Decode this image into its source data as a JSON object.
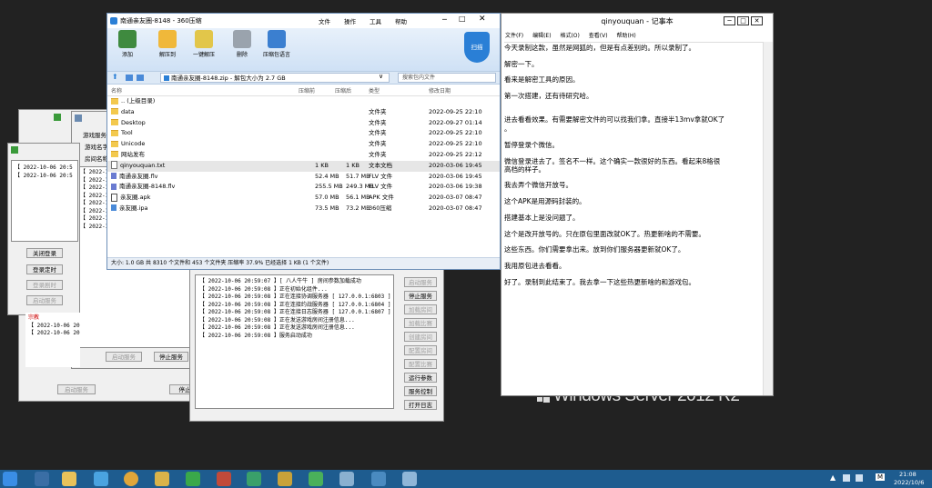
{
  "desktop": {
    "brand": "Windows Server 2012 R2"
  },
  "back_windows": {
    "w1": {
      "log_lines": [
        "【 2022-10-06 20:5",
        "【 2022-10-06 20:5"
      ],
      "buttons": [
        "关闭登录",
        "登录定时",
        "登录剧时",
        "启动服务"
      ],
      "extra_tag": "宗教",
      "log2": [
        "【 2022-10-06 20:5",
        "【 2022-10-06 20:5"
      ]
    },
    "w2": {
      "labels": [
        "游戏服务器",
        "游戏名字",
        "房间名称"
      ],
      "log_lines": [
        "【 2022-10",
        "【 2022-10",
        "【 2022-10",
        "【 2022-10",
        "【 2022-10",
        "【 2022-10",
        "【 2022-10",
        "【 2022-10"
      ],
      "start_btn": "启动服务",
      "stop_btn": "停止服务"
    },
    "w3": {
      "start_btn": "启动服务",
      "stop_btn": "停止"
    }
  },
  "server_window": {
    "log_lines": [
      "【 2022-10-06 20:59:07 】[ 八人牛牛 ] 房间参数加载成功",
      "【 2022-10-06 20:59:08 】正在初始化组件...",
      "【 2022-10-06 20:59:08 】正在连接协调服务器 [ 127.0.0.1:6803 ]",
      "【 2022-10-06 20:59:08 】正在连接约战服务器 [ 127.0.0.1:6804 ]",
      "【 2022-10-06 20:59:08 】正在连接日志服务器 [ 127.0.0.1:6807 ]",
      "【 2022-10-06 20:59:08 】正在发送游戏房间注册信息...",
      "【 2022-10-06 20:59:08 】正在发送游戏房间注册信息...",
      "【 2022-10-06 20:59:08 】服务启动成功"
    ],
    "buttons": [
      {
        "label": "启动服务",
        "enabled": false
      },
      {
        "label": "停止服务",
        "enabled": true
      },
      {
        "label": "加载房间",
        "enabled": false
      },
      {
        "label": "加载比赛",
        "enabled": false
      },
      {
        "label": "创建房间",
        "enabled": false
      },
      {
        "label": "配置房间",
        "enabled": false
      },
      {
        "label": "配置比赛",
        "enabled": false
      },
      {
        "label": "运行参数",
        "enabled": true
      },
      {
        "label": "服务控制",
        "enabled": true
      },
      {
        "label": "打开日志",
        "enabled": true
      }
    ]
  },
  "zip": {
    "title": "南通亲友圈-8148 - 360压缩",
    "menu": [
      "文件",
      "操作",
      "工具",
      "帮助"
    ],
    "toolbar": [
      "添加",
      "解压到",
      "一键解压",
      "删除",
      "压缩包语言"
    ],
    "scan_label": "扫描",
    "address": "南通亲友圈-8148.zip - 解包大小为 2.7 GB",
    "search_placeholder": "搜索包内文件",
    "columns": [
      "名称",
      "压缩前",
      "压缩后",
      "类型",
      "修改日期"
    ],
    "files": [
      {
        "name": ".. (上级目录)",
        "before": "",
        "after": "",
        "type": "",
        "date": "",
        "icon": "folder"
      },
      {
        "name": "data",
        "before": "",
        "after": "",
        "type": "文件夹",
        "date": "2022-09-25 22:10",
        "icon": "folder"
      },
      {
        "name": "Desktop",
        "before": "",
        "after": "",
        "type": "文件夹",
        "date": "2022-09-27 01:14",
        "icon": "folder"
      },
      {
        "name": "Tool",
        "before": "",
        "after": "",
        "type": "文件夹",
        "date": "2022-09-25 22:10",
        "icon": "folder"
      },
      {
        "name": "Unicode",
        "before": "",
        "after": "",
        "type": "文件夹",
        "date": "2022-09-25 22:10",
        "icon": "folder"
      },
      {
        "name": "网站发布",
        "before": "",
        "after": "",
        "type": "文件夹",
        "date": "2022-09-25 22:12",
        "icon": "folder"
      },
      {
        "name": "qinyouquan.txt",
        "before": "1 KB",
        "after": "1 KB",
        "type": "文本文档",
        "date": "2020-03-06 19:45",
        "icon": "file"
      },
      {
        "name": "南通亲友圈.flv",
        "before": "52.4 MB",
        "after": "51.7 MB",
        "type": "FLV 文件",
        "date": "2020-03-06 19:45",
        "icon": "flv"
      },
      {
        "name": "南通亲友圈-8148.flv",
        "before": "255.5 MB",
        "after": "249.3 MB",
        "type": "FLV 文件",
        "date": "2020-03-06 19:38",
        "icon": "flv"
      },
      {
        "name": "亲友圈.apk",
        "before": "57.0 MB",
        "after": "56.1 MB",
        "type": "APK 文件",
        "date": "2020-03-07 08:47",
        "icon": "apk"
      },
      {
        "name": "亲友圈.ipa",
        "before": "73.5 MB",
        "after": "73.2 MB",
        "type": "360压缩",
        "date": "2020-03-07 08:47",
        "icon": "ipa"
      }
    ],
    "status": "大小: 1.0 GB 共 8310 个文件和 453 个文件夹 压缩率 37.9% 已经选择 1 KB (1 个文件)"
  },
  "notepad": {
    "title": "qinyouquan - 记事本",
    "menu": [
      "文件(F)",
      "编辑(E)",
      "格式(O)",
      "查看(V)",
      "帮助(H)"
    ],
    "lines": [
      "今天录制这款，虽然是网狐的，但是有点差别的。所以录制了。",
      "解密一下。",
      "看来是解密工具的原因。",
      "第一次搭建，还有待研究哈。",
      "进去看看效果。有需要解密文件的可以找我们拿。直接半13mv拿就OK了",
      "。",
      "暂停登录个微信。",
      "微信登录进去了。签名不一样。这个确实一款很好的东西。看起来8格很",
      "高档的样子。",
      "我去弄个微信开放号。",
      "这个APK是用源码封装的。",
      "搭建基本上是没问题了。",
      "这个是改开放号的。只在原包里面改就OK了。热更新啥的不需要。",
      "这些东西。你们需要拿出来。放到你们服务器更新就OK了。",
      "我用原包进去看看。",
      "好了。录制到此结束了。我去拿一下这些热更新啥的和游戏包。"
    ]
  },
  "taskbar": {
    "time": "21:08",
    "date": "2022/10/6",
    "tray_letter": "M"
  },
  "colors": {
    "taskbar": "#1e5c8f",
    "desktop": "#222222",
    "zip_accent": "#2a7fd6"
  }
}
